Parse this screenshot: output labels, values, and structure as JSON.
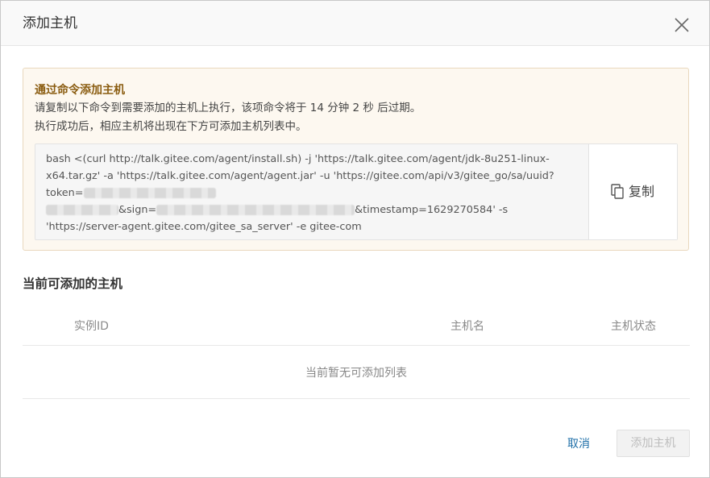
{
  "modal": {
    "title": "添加主机",
    "close_icon": "close-icon"
  },
  "notice": {
    "title": "通过命令添加主机",
    "line1": "请复制以下命令到需要添加的主机上执行，该项命令将于 14 分钟 2 秒 后过期。",
    "line2": "执行成功后，相应主机将出现在下方可添加主机列表中。",
    "command": {
      "row1": "bash <(curl http://talk.gitee.com/agent/install.sh) -j 'https://talk.gitee.com/agent/jdk-8u251-linux-",
      "row2": "x64.tar.gz' -a 'https://talk.gitee.com/agent/agent.jar' -u 'https://gitee.com/api/v3/gitee_go/sa/uuid?",
      "row3_prefix": "token=",
      "row4_sign": "&sign=",
      "row4_timestamp": "&timestamp=1629270584' -s",
      "row5": "'https://server-agent.gitee.com/gitee_sa_server' -e gitee-com"
    },
    "copy_label": "复制",
    "copy_icon": "copy-icon"
  },
  "hosts": {
    "section_title": "当前可添加的主机",
    "columns": [
      "实例ID",
      "主机名",
      "主机状态"
    ],
    "empty_text": "当前暂无可添加列表"
  },
  "footer": {
    "cancel_label": "取消",
    "add_label": "添加主机"
  },
  "colors": {
    "notice_title": "#8a5c10",
    "link": "#1f6fa8",
    "disabled_text": "#bdbdbd"
  }
}
